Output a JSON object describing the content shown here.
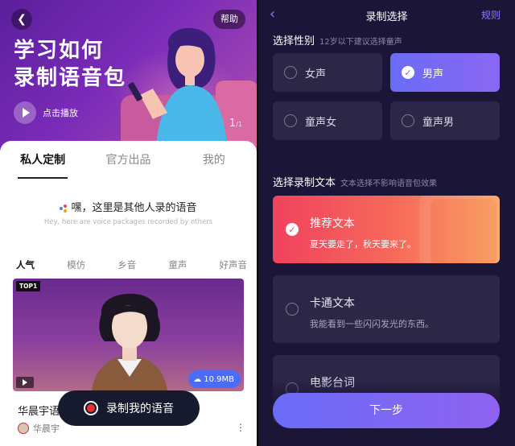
{
  "left": {
    "help_label": "帮助",
    "hero_title_line1": "学习如何",
    "hero_title_line2": "录制语音包",
    "play_label": "点击播放",
    "pager_current": "1",
    "pager_total": "/1",
    "main_tabs": [
      "私人定制",
      "官方出品",
      "我的"
    ],
    "hint_text": "嘿，这里是其他人录的语音",
    "hint_sub": "Hey, here are voice packages recorded by others",
    "categories": [
      "人气",
      "模仿",
      "乡音",
      "童声",
      "好声音"
    ],
    "card": {
      "badge": "TOP1",
      "size": "10.9MB",
      "name": "华晨宇语",
      "user": "华晨宇"
    },
    "record_label": "录制我的语音"
  },
  "right": {
    "title": "录制选择",
    "rules_label": "规则",
    "gender_section": "选择性别",
    "gender_hint": "12岁以下建议选择童声",
    "gender_options": [
      "女声",
      "男声",
      "童声女",
      "童声男"
    ],
    "text_section": "选择录制文本",
    "text_hint": "文本选择不影响语音包效果",
    "text_options": [
      {
        "title": "推荐文本",
        "desc": "夏天要走了，秋天要来了。"
      },
      {
        "title": "卡通文本",
        "desc": "我能看到一些闪闪发光的东西。"
      },
      {
        "title": "电影台词",
        "desc": ""
      }
    ],
    "next_label": "下一步"
  },
  "colors": {
    "accent_purple": "#6a6cf7",
    "recommend_gradient_start": "#f0425e",
    "recommend_gradient_end": "#f9a063",
    "dark_bg": "#1b1538",
    "record_dot": "#e3342f"
  },
  "icons": [
    "back-arrow-icon",
    "play-icon",
    "cloud-download-icon",
    "record-icon",
    "check-icon",
    "more-icon"
  ]
}
